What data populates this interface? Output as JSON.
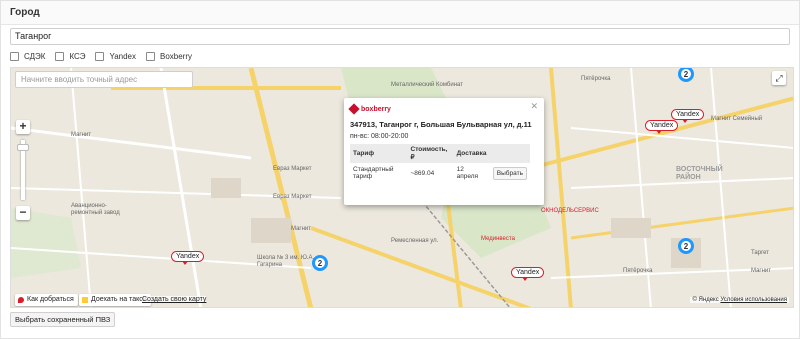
{
  "header": {
    "title": "Город"
  },
  "city": {
    "value": "Таганрог"
  },
  "carriers": [
    {
      "label": "СДЭК",
      "checked": false
    },
    {
      "label": "КСЭ",
      "checked": false
    },
    {
      "label": "Yandex",
      "checked": false
    },
    {
      "label": "Boxberry",
      "checked": false
    }
  ],
  "map": {
    "address_placeholder": "Начните вводить точный адрес",
    "zoom_in": "+",
    "zoom_out": "−",
    "labels": [
      "Металлический Комбинат",
      "Магнит",
      "Евраз Маркет",
      "Евраз Маркет",
      "Аванционно-ремонтный завод",
      "Магнит",
      "Школа № 3 им. Ю.А. Гагарина",
      "Ремесленная ул.",
      "Мединвеста",
      "ОКНОДЕЛЬСЕРВИС",
      "Магнит Семейный",
      "Пятёрочка",
      "Пятёрочка",
      "ВОСТОЧНЫЙ РАЙОН",
      "Таргет",
      "Магнит"
    ],
    "clusters": [
      "2",
      "2",
      "2"
    ],
    "tags": [
      "Yandex",
      "Yandex",
      "Yandex",
      "Yandex"
    ],
    "route_button": "Как добраться",
    "taxi_button": "Доехать на такси",
    "create_map": "Создать свою карту",
    "copyright": "© Яндекс",
    "terms": "Условия использования"
  },
  "popup": {
    "brand": "boxberry",
    "address": "347913, Таганрог г, Большая Бульварная ул, д.11",
    "hours": "пн-вс: 08:00-20:00",
    "columns": [
      "Тариф",
      "Стоимость, ₽",
      "Доставка"
    ],
    "row": {
      "tariff": "Стандартный тариф",
      "cost": "~869.04",
      "delivery": "12 апреля",
      "button": "Выбрать"
    }
  },
  "save_button": "Выбрать сохраненный ПВЗ",
  "colors": {
    "accent": "#1e98ff",
    "tag_border": "#d91e2a",
    "brand": "#c8102e"
  }
}
